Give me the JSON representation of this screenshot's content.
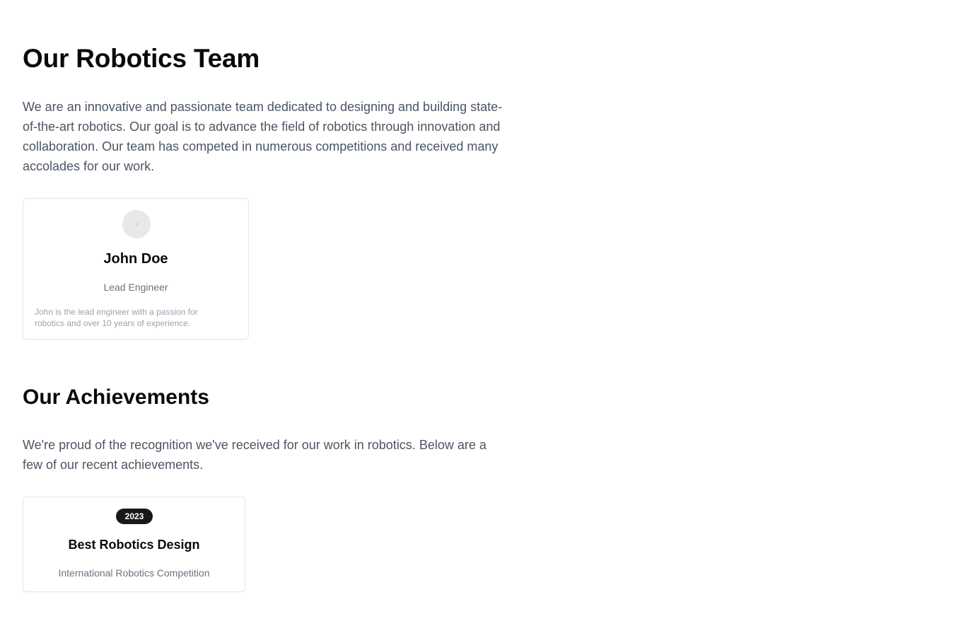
{
  "team_section": {
    "title": "Our Robotics Team",
    "description": "We are an innovative and passionate team dedicated to designing and building state-of-the-art robotics. Our goal is to advance the field of robotics through innovation and collaboration. Our team has competed in numerous competitions and received many accolades for our work.",
    "members": [
      {
        "name": "John Doe",
        "role": "Lead Engineer",
        "bio": "John is the lead engineer with a passion for robotics and over 10 years of experience.",
        "avatar_icon": "avatar-placeholder-icon"
      }
    ]
  },
  "achievements_section": {
    "title": "Our Achievements",
    "description": "We're proud of the recognition we've received for our work in robotics. Below are a few of our recent achievements.",
    "items": [
      {
        "year": "2023",
        "title": "Best Robotics Design",
        "event": "International Robotics Competition"
      }
    ]
  },
  "colors": {
    "heading": "#0a0a0a",
    "body_text": "#4b5563",
    "muted_text": "#6b7280",
    "faint_text": "#9ca3af",
    "card_border": "#e5e7eb",
    "badge_bg": "#18181b",
    "badge_text": "#ffffff",
    "avatar_bg": "#e8e8e8"
  }
}
